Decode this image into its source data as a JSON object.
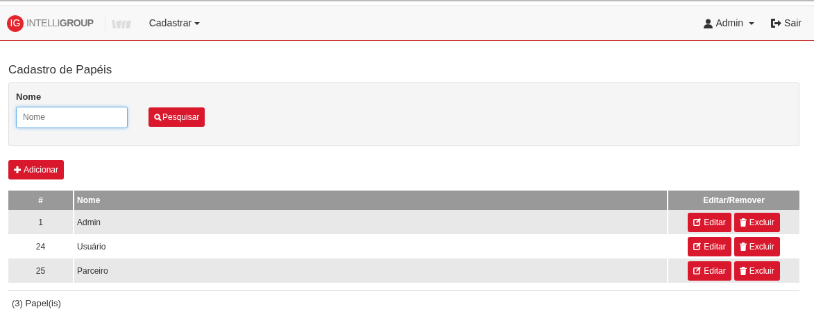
{
  "brand": {
    "badge": "IG",
    "name": "INTELLI**GROUP**"
  },
  "nav": {
    "menu": "Cadastrar",
    "user": "Admin",
    "logout": "Sair"
  },
  "title": "Cadastro de Papéis",
  "filter": {
    "label": "Nome",
    "placeholder": "Nome",
    "search_button": "Pesquisar"
  },
  "add_button": "Adicionar",
  "table": {
    "columns": [
      "#",
      "Nome",
      "Editar/Remover"
    ],
    "rows": [
      {
        "id": "1",
        "name": "Admin",
        "edit": "Editar",
        "delete": "Excluir"
      },
      {
        "id": "24",
        "name": "Usuário",
        "edit": "Editar",
        "delete": "Excluir"
      },
      {
        "id": "25",
        "name": "Parceiro",
        "edit": "Editar",
        "delete": "Excluir"
      }
    ]
  },
  "footer": "(3) Papel(is)"
}
